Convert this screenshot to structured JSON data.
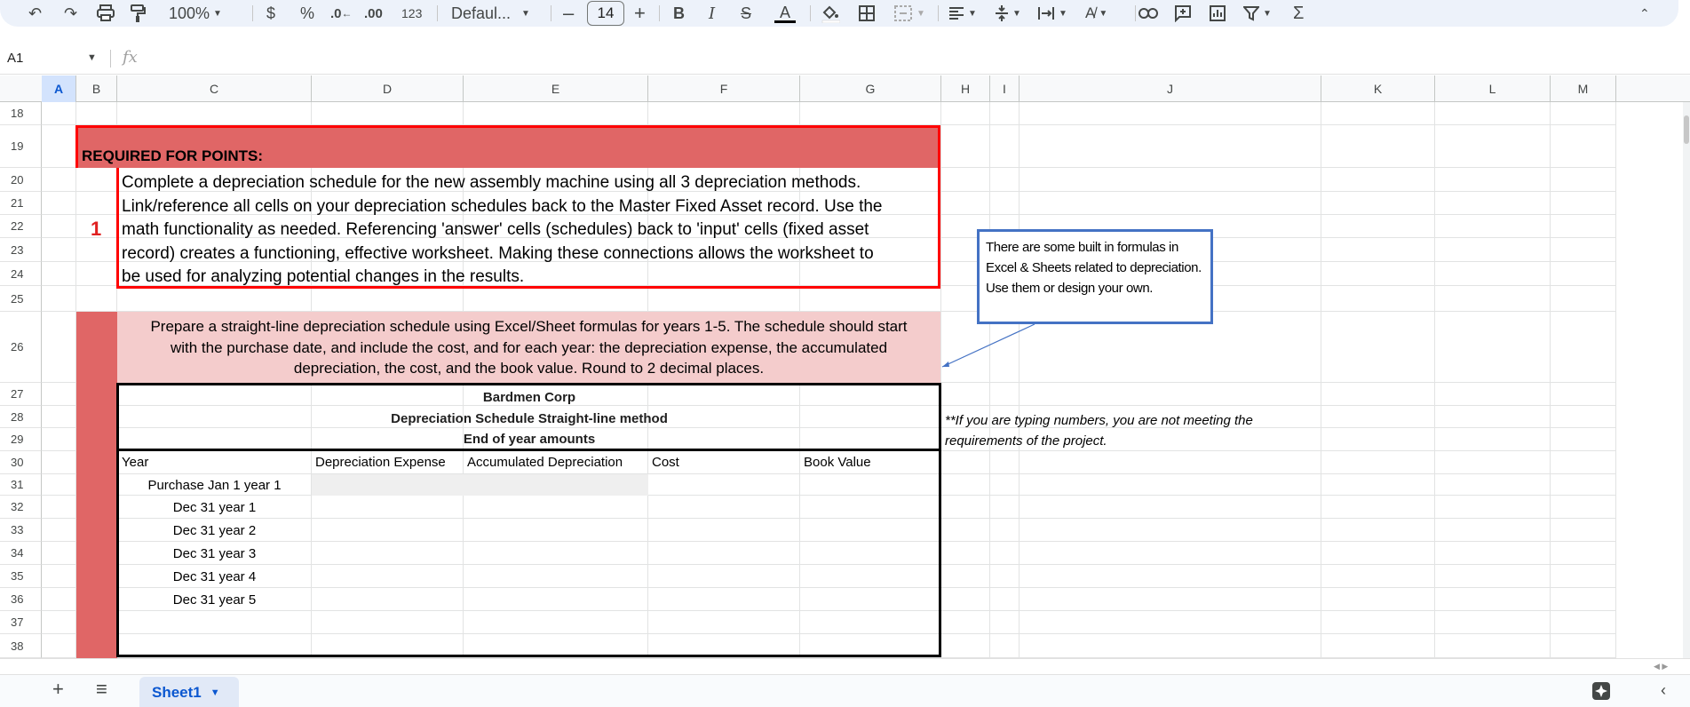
{
  "toolbar": {
    "zoom": "100%",
    "currency": "$",
    "percent": "%",
    "dec_decrease": ".0",
    "dec_increase": ".00",
    "number_format": "123",
    "font": "Defaul...",
    "font_size": "14",
    "bold": "B",
    "italic": "I",
    "text_color": "A"
  },
  "formula_bar": {
    "cell_ref": "A1",
    "fx": "fx"
  },
  "columns": [
    "A",
    "B",
    "C",
    "D",
    "E",
    "F",
    "G",
    "H",
    "I",
    "J",
    "K",
    "L",
    "M"
  ],
  "rows": [
    "18",
    "19",
    "20",
    "21",
    "22",
    "23",
    "24",
    "25",
    "26",
    "27",
    "28",
    "29",
    "30",
    "31",
    "32",
    "33",
    "34",
    "35",
    "36",
    "37",
    "38"
  ],
  "sheet": {
    "required_header": "REQUIRED FOR POINTS:",
    "item_number": "1",
    "instruction_lines": [
      "Complete a depreciation schedule for the new assembly machine using all 3 depreciation methods.",
      "Link/reference all cells on your depreciation schedules back to the Master Fixed Asset record.  Use the",
      "math functionality as needed. Referencing 'answer' cells (schedules) back to 'input' cells (fixed asset",
      "record) creates a functioning, effective worksheet. Making these connections allows the worksheet to",
      "be used for analyzing potential changes in the results."
    ],
    "note_box": "There are some built in formulas in Excel & Sheets related to depreciation.  Use them or design your own.",
    "straightline_lines": [
      "Prepare a straight-line depreciation schedule using Excel/Sheet formulas for years 1-5.  The schedule should start",
      "with the purchase date, and include the cost, and for each year: the depreciation expense, the accumulated",
      "depreciation, the cost, and the book value.  Round to 2 decimal places."
    ],
    "company": "Bardmen Corp",
    "schedule_title": "Depreciation Schedule Straight-line method",
    "schedule_subtitle": "End of year amounts",
    "warning_lines": [
      "**If you are typing numbers, you are not meeting the",
      "requirements of the project."
    ],
    "table_headers": [
      "Year",
      "Depreciation Expense",
      "Accumulated Depreciation",
      "Cost",
      "Book Value"
    ],
    "years": [
      "Purchase Jan 1 year 1",
      "Dec 31 year 1",
      "Dec 31 year 2",
      "Dec 31 year 3",
      "Dec 31 year 4",
      "Dec 31 year 5"
    ]
  },
  "bottom": {
    "sheet_tab": "Sheet1"
  },
  "colors": {
    "red_header": "#e06666",
    "pink_fill": "#f4cccc",
    "red_border": "#ff0000",
    "blue_box": "#4472c4",
    "accent": "#0b57d0"
  }
}
